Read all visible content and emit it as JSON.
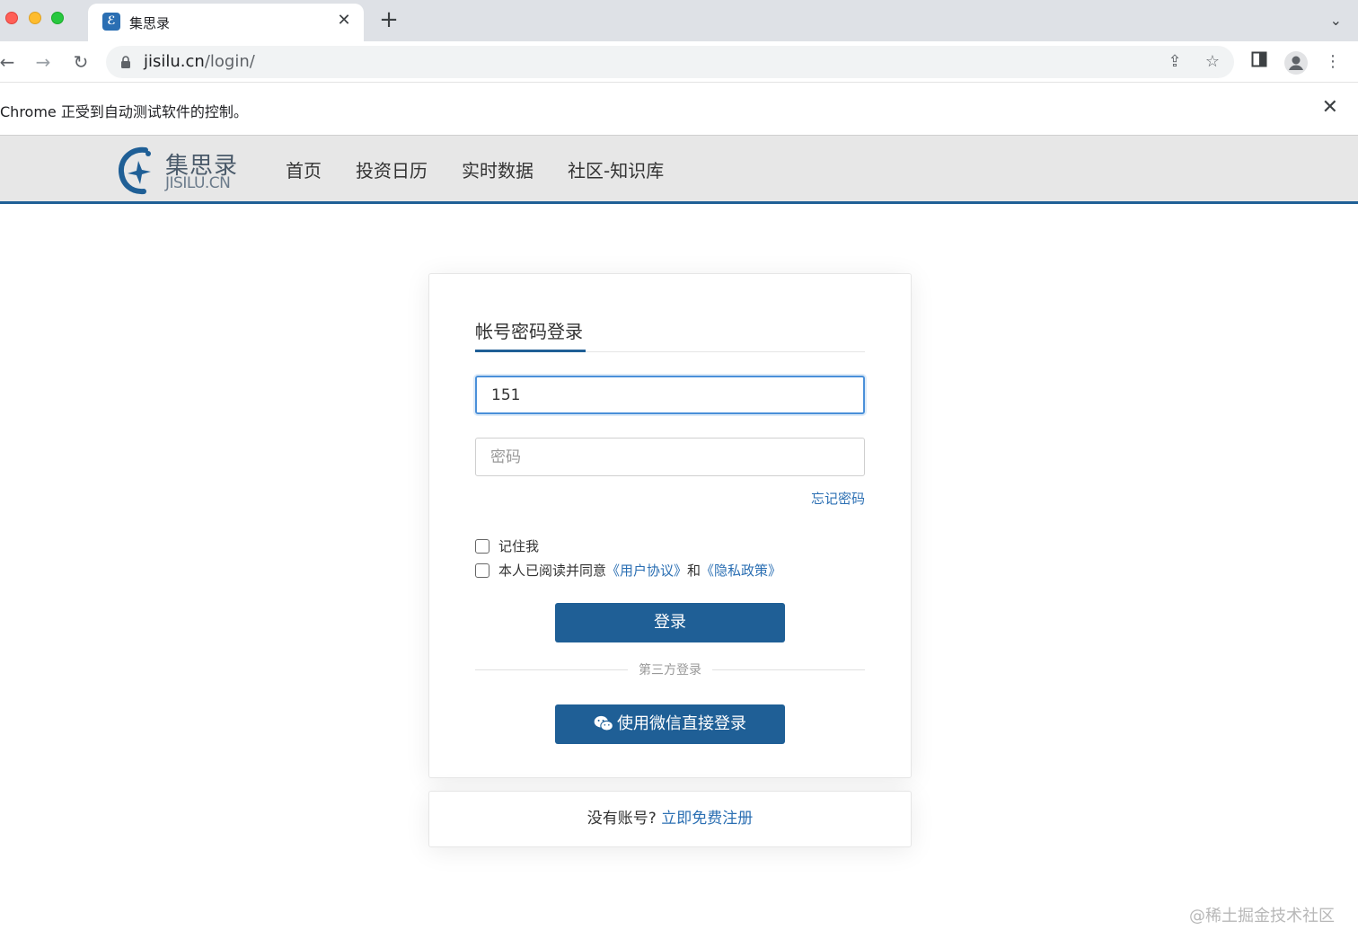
{
  "browser": {
    "tab_title": "集思录",
    "url_host": "jisilu.cn",
    "url_path": "/login/",
    "automation_notice": "Chrome 正受到自动测试软件的控制。"
  },
  "site": {
    "logo_cn": "集思录",
    "logo_en": "JISILU.CN",
    "nav": [
      "首页",
      "投资日历",
      "实时数据",
      "社区-知识库"
    ],
    "brand_color": "#1f5f96"
  },
  "login": {
    "tab_label": "帐号密码登录",
    "username_value": "151",
    "password_placeholder": "密码",
    "forgot_label": "忘记密码",
    "remember_label": "记住我",
    "agree_prefix": "本人已阅读并同意",
    "user_agreement": "《用户协议》",
    "agree_and": "和",
    "privacy_policy": "《隐私政策》",
    "submit_label": "登录",
    "third_party_label": "第三方登录",
    "wechat_label": "使用微信直接登录"
  },
  "register": {
    "prompt": "没有账号?",
    "link": "立即免费注册"
  },
  "watermark": "@稀土掘金技术社区"
}
